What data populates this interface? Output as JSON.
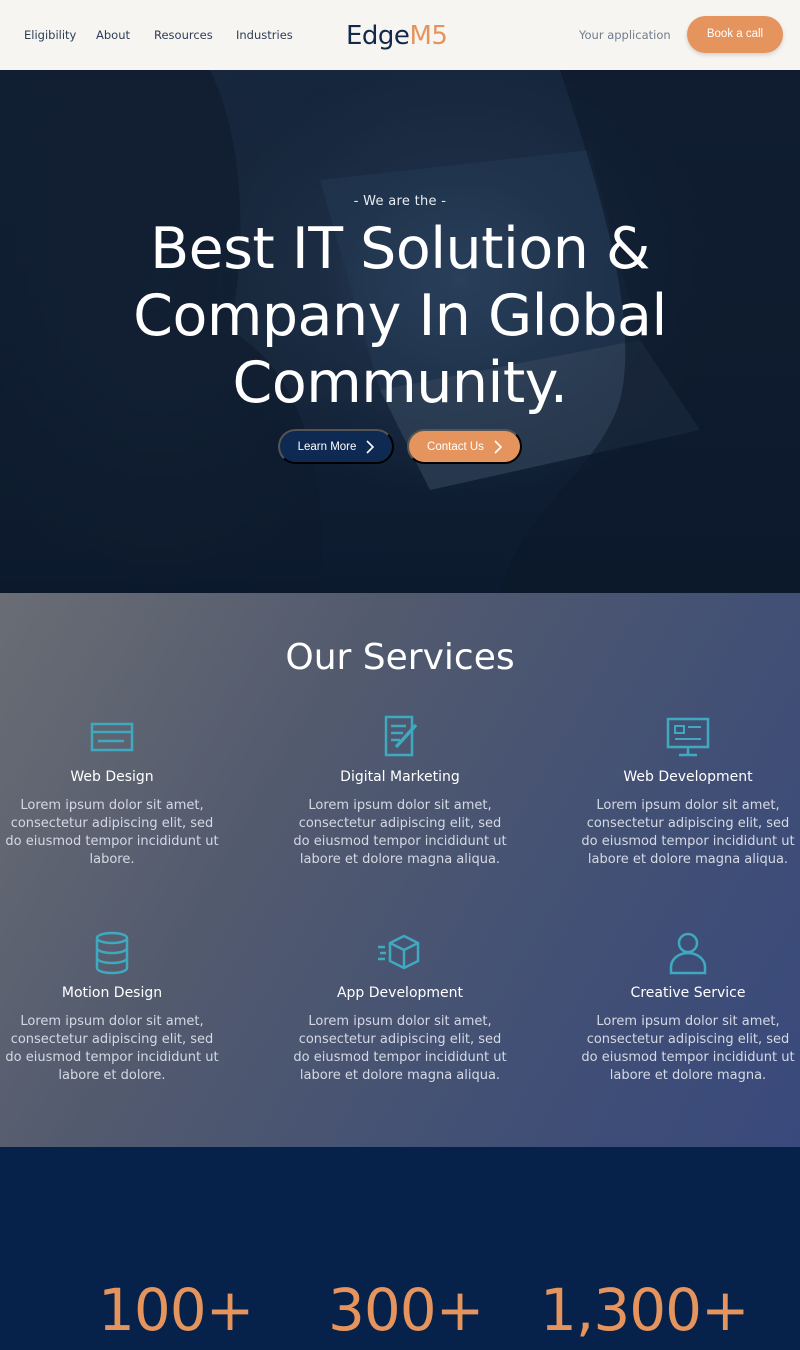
{
  "nav": {
    "links": [
      "Eligibility",
      "About",
      "Resources",
      "Industries"
    ],
    "logo_part1": "Edge",
    "logo_part2": "M5",
    "application_link": "Your application",
    "book_button": "Book a call"
  },
  "hero": {
    "eyebrow": "- We are the -",
    "title": "Best IT Solution & Company In Global Community.",
    "learn_more": "Learn More",
    "contact_us": "Contact Us"
  },
  "services": {
    "title": "Our Services",
    "items": [
      {
        "title": "Web Design",
        "text": "Lorem ipsum dolor sit amet, consectetur adipiscing elit, sed do eiusmod tempor incididunt ut labore.",
        "icon": "card-icon"
      },
      {
        "title": "Digital Marketing",
        "text": "Lorem ipsum dolor sit amet, consectetur adipiscing elit, sed do eiusmod tempor incididunt ut labore et dolore magna aliqua.",
        "icon": "document-edit-icon"
      },
      {
        "title": "Web Development",
        "text": "Lorem ipsum dolor sit amet, consectetur adipiscing elit, sed do eiusmod tempor incididunt ut labore et dolore magna aliqua.",
        "icon": "monitor-icon"
      },
      {
        "title": "Motion Design",
        "text": "Lorem ipsum dolor sit amet, consectetur adipiscing elit, sed do eiusmod tempor incididunt ut labore et dolore.",
        "icon": "database-icon"
      },
      {
        "title": "App Development",
        "text": "Lorem ipsum dolor sit amet, consectetur adipiscing elit, sed do eiusmod tempor incididunt ut labore et dolore magna aliqua.",
        "icon": "cube-icon"
      },
      {
        "title": "Creative Service",
        "text": "Lorem ipsum dolor sit amet, consectetur adipiscing elit, sed do eiusmod tempor incididunt ut labore et dolore magna.",
        "icon": "user-icon"
      }
    ]
  },
  "stats": [
    "100+",
    "300+",
    "1,300+"
  ],
  "colors": {
    "accent": "#e5945d",
    "navy": "#0f2a52",
    "icon_teal": "#3fa9c0"
  }
}
